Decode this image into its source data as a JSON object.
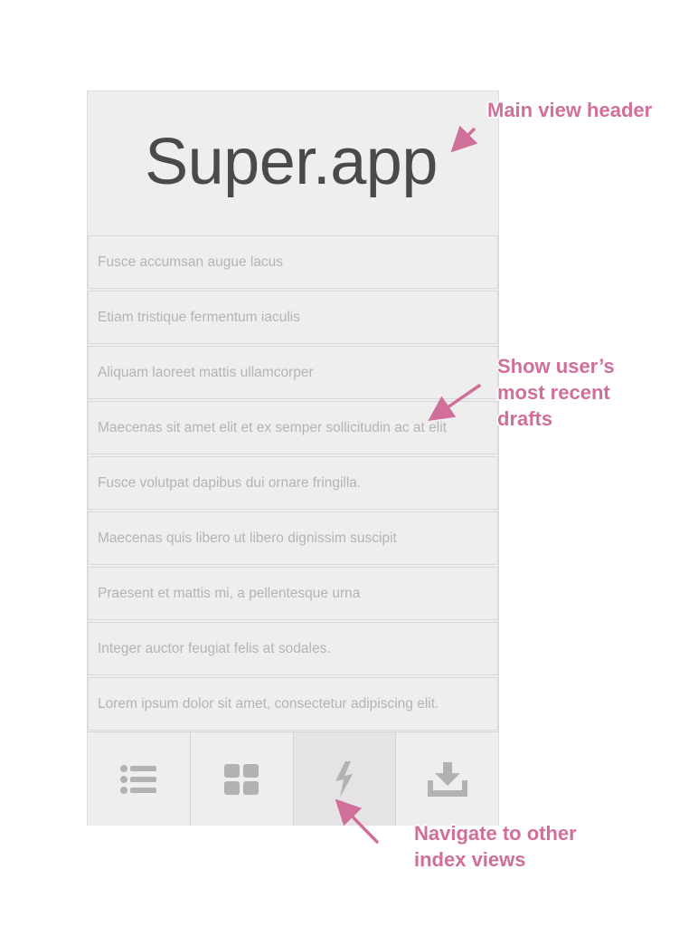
{
  "app": {
    "title": "Super.app"
  },
  "drafts": [
    "Fusce accumsan augue lacus",
    "Etiam tristique fermentum iaculis",
    "Aliquam laoreet mattis ullamcorper",
    "Maecenas sit amet elit et ex semper sollicitudin ac at elit",
    "Fusce volutpat dapibus dui ornare fringilla.",
    "Maecenas quis libero ut libero dignissim suscipit",
    "Praesent et mattis mi, a pellentesque urna",
    "Integer auctor feugiat felis at sodales.",
    "Lorem ipsum dolor sit amet, consectetur adipiscing elit."
  ],
  "tabs": [
    {
      "icon": "list-icon",
      "active": false
    },
    {
      "icon": "grid-icon",
      "active": false
    },
    {
      "icon": "lightning-icon",
      "active": true
    },
    {
      "icon": "download-icon",
      "active": false
    }
  ],
  "annotations": {
    "header": [
      "Main view header"
    ],
    "drafts": [
      "Show user’s",
      "most recent",
      "drafts"
    ],
    "navigation": [
      "Navigate to other",
      "index views"
    ]
  },
  "colors": {
    "annotation": "#cf6f9a",
    "background": "#efeeef",
    "icon": "#b3b1b3",
    "title": "#4b4a4b"
  }
}
